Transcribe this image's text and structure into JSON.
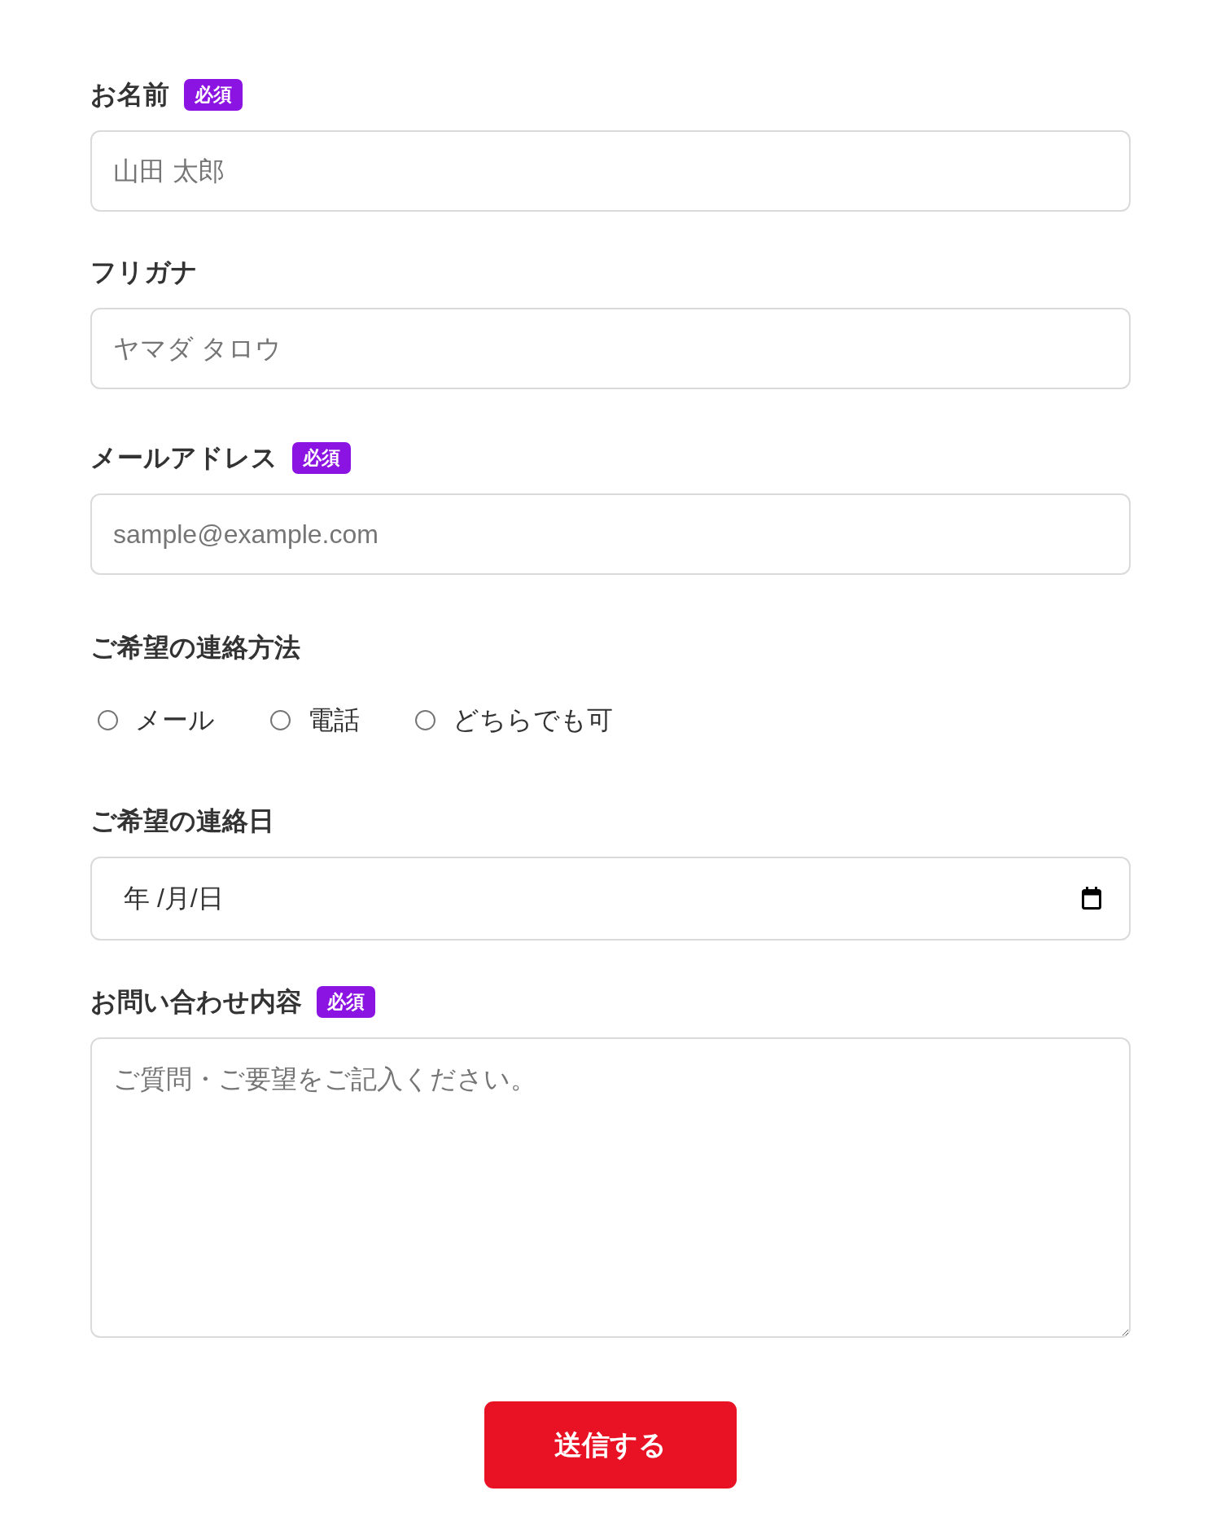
{
  "form": {
    "fields": [
      {
        "kind": "text",
        "label": "お名前",
        "badge": "必須",
        "placeholder": "山田 太郎"
      },
      {
        "kind": "text",
        "label": "フリガナ",
        "placeholder": "ヤマダ タロウ"
      },
      {
        "kind": "email",
        "label": "メールアドレス",
        "badge": "必須",
        "placeholder": "sample@example.com"
      },
      {
        "kind": "radio",
        "label": "ご希望の連絡方法",
        "options": [
          {
            "label": "メール",
            "selected": false
          },
          {
            "label": "電話",
            "selected": false
          },
          {
            "label": "どちらでも可",
            "selected": false
          }
        ]
      },
      {
        "kind": "date",
        "label": "ご希望の連絡日",
        "placeholder": "年 /月/日"
      },
      {
        "kind": "textarea",
        "label": "お問い合わせ内容",
        "badge": "必須",
        "placeholder": "ご質問・ご要望をご記入ください。"
      }
    ],
    "submit_button": "送信する"
  }
}
